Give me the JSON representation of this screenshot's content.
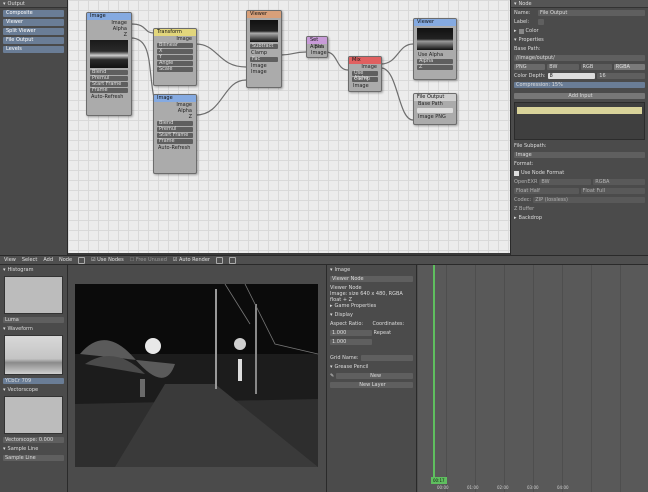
{
  "output_panel": {
    "title": "Output",
    "items": [
      "Composite",
      "Viewer",
      "Split Viewer",
      "File Output",
      "Levels"
    ]
  },
  "nodes": {
    "image1": {
      "title": "Image",
      "sockets": [
        "Image",
        "Alpha",
        "Z"
      ],
      "fields": [
        "Blend",
        "Premul",
        "Start Frame",
        "Frame",
        "Auto-Refresh"
      ]
    },
    "translate": {
      "title": "Transform",
      "sockets": [
        "Image"
      ],
      "fields": [
        "Bilinear",
        "X",
        "Y",
        "Angle",
        "Scale"
      ]
    },
    "image2": {
      "title": "Image",
      "sockets": [
        "Image",
        "Alpha",
        "Z"
      ],
      "fields": [
        "Blend",
        "Premul",
        "Start Frame",
        "Frame",
        "Auto-Refresh"
      ]
    },
    "viewer1": {
      "title": "Viewer",
      "fields": [
        "Subtract",
        "Clamp",
        "Fac",
        "Image",
        "Image"
      ]
    },
    "rgbcurves": {
      "title": "Set Alpha",
      "sockets": [
        "Set"
      ],
      "fields": [
        "Image"
      ]
    },
    "mix": {
      "title": "Mix",
      "sockets": [
        "Image"
      ],
      "fields": [
        "Use Alpha",
        "Clamp",
        "Image"
      ]
    },
    "viewer2": {
      "title": "Viewer",
      "fields": [
        "Use Alpha",
        "Alpha",
        "Z"
      ]
    },
    "fileoutput": {
      "title": "File Output",
      "fields": [
        "Base Path",
        "Image",
        "PNG"
      ]
    }
  },
  "properties": {
    "section_node": "Node",
    "name_label": "Name:",
    "name_value": "File Output",
    "label_label": "Label:",
    "color_label": "Color",
    "props_label": "Properties",
    "base_path_label": "Base Path:",
    "base_path_value": "//image/output/",
    "format_items": [
      "PNG",
      "BW",
      "RGB",
      "RGBA"
    ],
    "color_depth_label": "Color Depth:",
    "color_depth_a": "8",
    "color_depth_b": "16",
    "compression_label": "Compression:",
    "compression_value": "15%",
    "add_input_label": "Add Input",
    "file_subpath_label": "File Subpath:",
    "file_subpath_value": "Image",
    "format_label": "Format:",
    "use_node_format": "Use Node Format",
    "openexr_label": "OpenEXR",
    "openexr_items": [
      "BW",
      "RGBA"
    ],
    "color_depth2": [
      "Float Half",
      "Float Full"
    ],
    "codec_label": "Codec:",
    "codec_value": "ZIP (lossless)",
    "zbuffer": "Z Buffer",
    "backdrop_label": "Backdrop"
  },
  "toolbar": {
    "items": [
      "View",
      "Select",
      "Add",
      "Node"
    ],
    "use_nodes": "Use Nodes",
    "free_unused": "Free Unused",
    "auto_render": "Auto Render"
  },
  "scopes": {
    "histogram": "Histogram",
    "waveform": "Waveform",
    "vectorscope": "Vectorscope",
    "sample_line": "Sample Line",
    "sample_btn": "Sample Line",
    "log_label": "Luma",
    "mode_value": "YCbCr 709",
    "var_label": "Vectorscope: 0.000"
  },
  "image_props": {
    "title": "Image",
    "image_name": "Viewer Node",
    "viewer_node_label": "Viewer Node",
    "image_info": "Image: size 640 x 480, RGBA float + Z",
    "game_props": "Game Properties",
    "display": "Display",
    "aspect_ratio": "Aspect Ratio:",
    "coordinates": "Coordinates:",
    "ar_x": "1.000",
    "ar_y": "1.000",
    "repeat": "Repeat",
    "grid_name": "Grid Name:",
    "grease_pencil": "Grease Pencil",
    "new_btn": "New",
    "new_layer_btn": "New Layer"
  },
  "timeline": {
    "current": "00:17",
    "ticks": [
      "00:00",
      "01:00",
      "02:00",
      "03:00",
      "04:00"
    ]
  },
  "colors": {
    "node_image": "#85aae1",
    "node_translate": "#e2d67c",
    "node_viewer": "#d8a07a",
    "node_alpha": "#c89bd8",
    "node_mix": "#e06060",
    "node_output": "#cfcfcf",
    "accent": "#6a7d96"
  }
}
